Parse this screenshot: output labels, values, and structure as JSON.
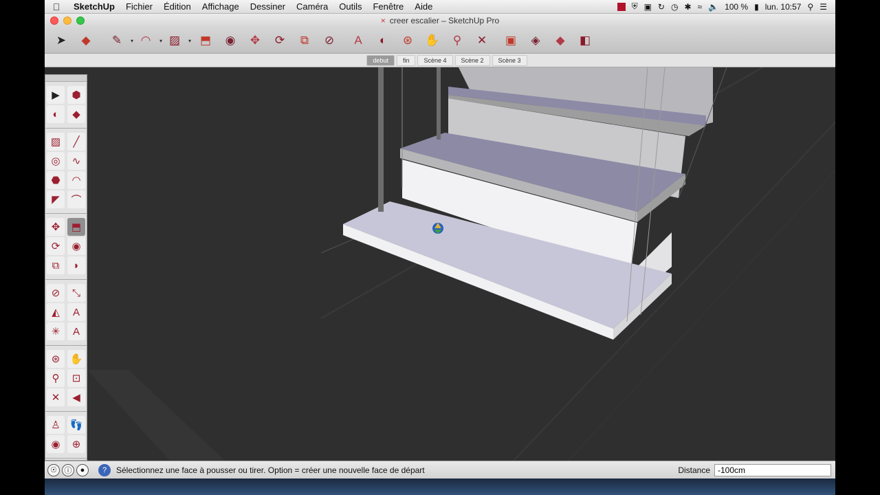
{
  "menubar": {
    "app_name": "SketchUp",
    "items": [
      "Fichier",
      "Édition",
      "Affichage",
      "Dessiner",
      "Caméra",
      "Outils",
      "Fenêtre",
      "Aide"
    ],
    "battery": "100 %",
    "clock": "lun. 10:57"
  },
  "window": {
    "title": "creer escalier – SketchUp Pro",
    "title_modified_mark": "×"
  },
  "toolbar": {
    "tools": [
      {
        "icon": "select-arrow-icon",
        "glyph": "➤"
      },
      {
        "icon": "eraser-icon",
        "glyph": "◆"
      },
      {
        "icon": "pencil-line-icon",
        "glyph": "✎",
        "dropdown": true
      },
      {
        "icon": "arc-icon",
        "glyph": "◠",
        "dropdown": true
      },
      {
        "icon": "rectangle-icon",
        "glyph": "▨",
        "dropdown": true
      },
      {
        "icon": "push-pull-icon",
        "glyph": "⬒"
      },
      {
        "icon": "follow-me-icon",
        "glyph": "◉"
      },
      {
        "icon": "move-icon",
        "glyph": "✥"
      },
      {
        "icon": "rotate-icon",
        "glyph": "⟳"
      },
      {
        "icon": "scale-icon",
        "glyph": "⧉"
      },
      {
        "icon": "tape-measure-icon",
        "glyph": "⊘"
      },
      {
        "icon": "text-icon",
        "glyph": "A"
      },
      {
        "icon": "paint-bucket-icon",
        "glyph": "◐"
      },
      {
        "icon": "orbit-icon",
        "glyph": "⊛"
      },
      {
        "icon": "pan-icon",
        "glyph": "✋"
      },
      {
        "icon": "zoom-icon",
        "glyph": "⚲"
      },
      {
        "icon": "zoom-extents-icon",
        "glyph": "✕"
      },
      {
        "icon": "warehouse-icon",
        "glyph": "▣"
      },
      {
        "icon": "share-model-icon",
        "glyph": "◈"
      },
      {
        "icon": "extension-warehouse-icon",
        "glyph": "◆"
      },
      {
        "icon": "layout-send-icon",
        "glyph": "◧"
      }
    ]
  },
  "scenes": {
    "tabs": [
      "debut",
      "fin",
      "Scène 4",
      "Scène 2",
      "Scène 3"
    ],
    "active": "debut"
  },
  "palette": {
    "groups": [
      [
        [
          "select-icon",
          "▶"
        ],
        [
          "make-component-icon",
          "⬢"
        ]
      ],
      [
        [
          "paint-bucket-icon",
          "◐"
        ],
        [
          "eraser-icon",
          "◆"
        ]
      ],
      [
        [
          "rectangle-icon",
          "▨"
        ],
        [
          "line-icon",
          "╱"
        ]
      ],
      [
        [
          "circle-icon",
          "◎"
        ],
        [
          "freehand-icon",
          "∿"
        ]
      ],
      [
        [
          "polygon-icon",
          "⬣"
        ],
        [
          "arc-icon",
          "◠"
        ]
      ],
      [
        [
          "pie-icon",
          "◤"
        ],
        [
          "two-point-arc-icon",
          "⌒"
        ]
      ],
      [
        [
          "move-icon",
          "✥"
        ],
        [
          "push-pull-icon",
          "⬒"
        ]
      ],
      [
        [
          "rotate-icon",
          "⟳"
        ],
        [
          "follow-me-icon",
          "◉"
        ]
      ],
      [
        [
          "scale-icon",
          "⧉"
        ],
        [
          "offset-icon",
          "◗"
        ]
      ],
      [
        [
          "tape-measure-icon",
          "⊘"
        ],
        [
          "dimension-icon",
          "⤡"
        ]
      ],
      [
        [
          "protractor-icon",
          "◭"
        ],
        [
          "text-icon",
          "A"
        ]
      ],
      [
        [
          "axes-icon",
          "✳"
        ],
        [
          "3d-text-icon",
          "A"
        ]
      ],
      [
        [
          "orbit-icon",
          "⊛"
        ],
        [
          "pan-icon",
          "✋"
        ]
      ],
      [
        [
          "zoom-icon",
          "⚲"
        ],
        [
          "zoom-window-icon",
          "⊡"
        ]
      ],
      [
        [
          "zoom-extents-icon",
          "✕"
        ],
        [
          "previous-view-icon",
          "◀"
        ]
      ],
      [
        [
          "position-camera-icon",
          "♙"
        ],
        [
          "walk-icon",
          "👣"
        ]
      ],
      [
        [
          "look-around-icon",
          "◉"
        ],
        [
          "section-plane-icon",
          "⊕"
        ]
      ]
    ],
    "selected": "push-pull-icon"
  },
  "statusbar": {
    "message": "Sélectionnez une face à pousser ou tirer. Option = créer une nouvelle face de départ",
    "vcb_label": "Distance",
    "vcb_value": "-100cm"
  },
  "colors": {
    "viewport_bg": "#2f2f2f",
    "tread_top": "#8c8aa5",
    "riser": "#f4f4f6",
    "accent_red": "#b1122a"
  }
}
